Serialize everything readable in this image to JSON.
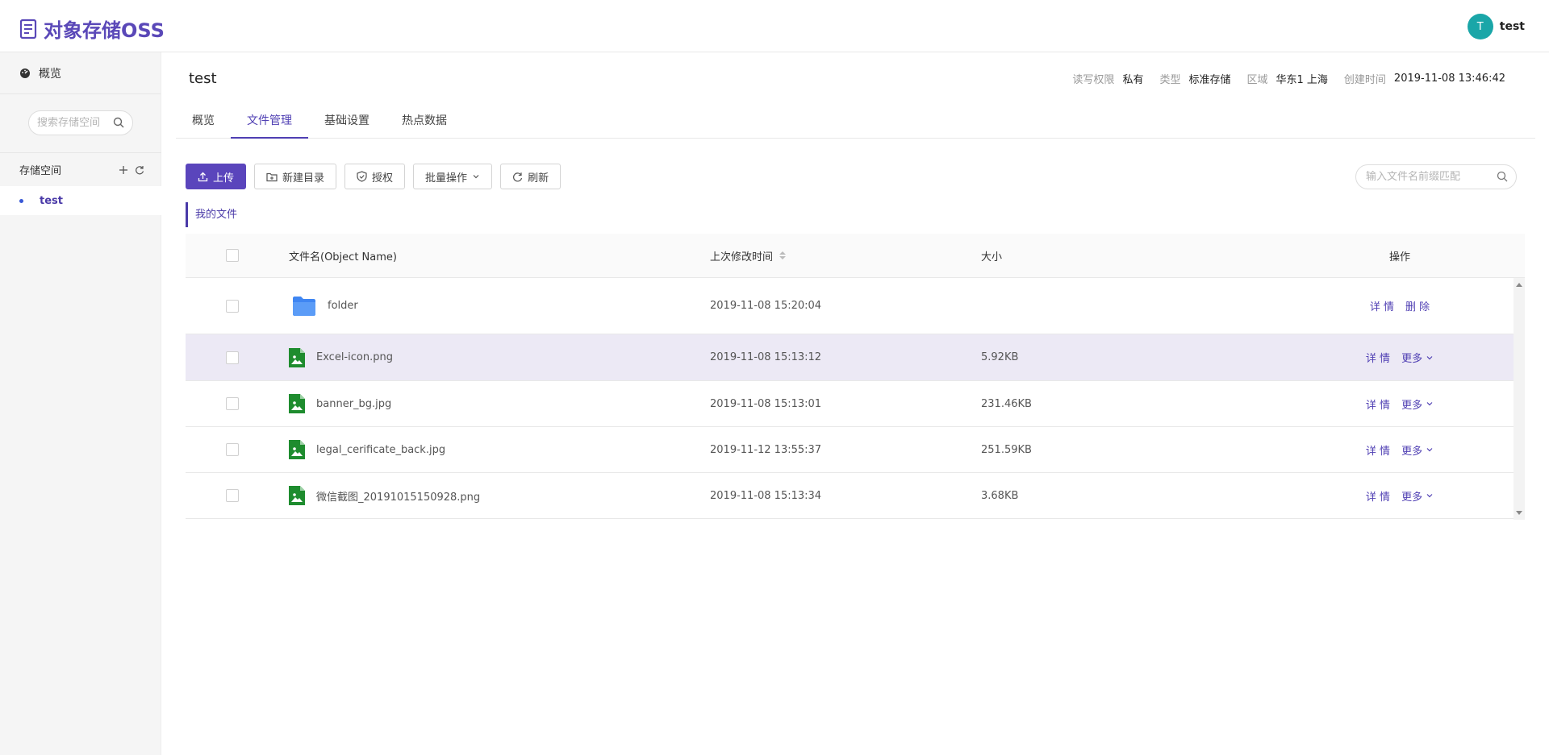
{
  "app": {
    "title": "对象存储OSS"
  },
  "user": {
    "initial": "T",
    "name": "test"
  },
  "sidebar": {
    "overview_label": "概览",
    "search_placeholder": "搜索存储空间",
    "bucket_section_label": "存储空间",
    "buckets": [
      {
        "name": "test"
      }
    ]
  },
  "bucket": {
    "title": "test",
    "meta": [
      {
        "key": "读写权限",
        "value": "私有"
      },
      {
        "key": "类型",
        "value": "标准存储"
      },
      {
        "key": "区域",
        "value": "华东1 上海"
      },
      {
        "key": "创建时间",
        "value": "2019-11-08 13:46:42"
      }
    ]
  },
  "tabs": [
    {
      "label": "概览"
    },
    {
      "label": "文件管理"
    },
    {
      "label": "基础设置"
    },
    {
      "label": "热点数据"
    }
  ],
  "toolbar": {
    "upload": "上传",
    "new_dir": "新建目录",
    "authorize": "授权",
    "batch": "批量操作",
    "refresh": "刷新",
    "search_placeholder": "输入文件名前缀匹配"
  },
  "breadcrumb": "我的文件",
  "table": {
    "headers": {
      "name": "文件名(Object Name)",
      "modified": "上次修改时间",
      "size": "大小",
      "ops": "操作"
    },
    "rows": [
      {
        "type": "folder",
        "name": "folder",
        "modified": "2019-11-08 15:20:04",
        "size": "",
        "op1": "详 情",
        "op2": "删 除"
      },
      {
        "type": "image",
        "name": "Excel-icon.png",
        "modified": "2019-11-08 15:13:12",
        "size": "5.92KB",
        "op1": "详 情",
        "op2": "更多"
      },
      {
        "type": "image",
        "name": "banner_bg.jpg",
        "modified": "2019-11-08 15:13:01",
        "size": "231.46KB",
        "op1": "详 情",
        "op2": "更多"
      },
      {
        "type": "image",
        "name": "legal_cerificate_back.jpg",
        "modified": "2019-11-12 13:55:37",
        "size": "251.59KB",
        "op1": "详 情",
        "op2": "更多"
      },
      {
        "type": "image",
        "name": "微信截图_20191015150928.png",
        "modified": "2019-11-08 15:13:34",
        "size": "3.68KB",
        "op1": "详 情",
        "op2": "更多"
      }
    ]
  },
  "colors": {
    "accent": "#5a45bc",
    "file_icon": "#1e8c2e",
    "folder_icon": "#4b8ef5"
  }
}
